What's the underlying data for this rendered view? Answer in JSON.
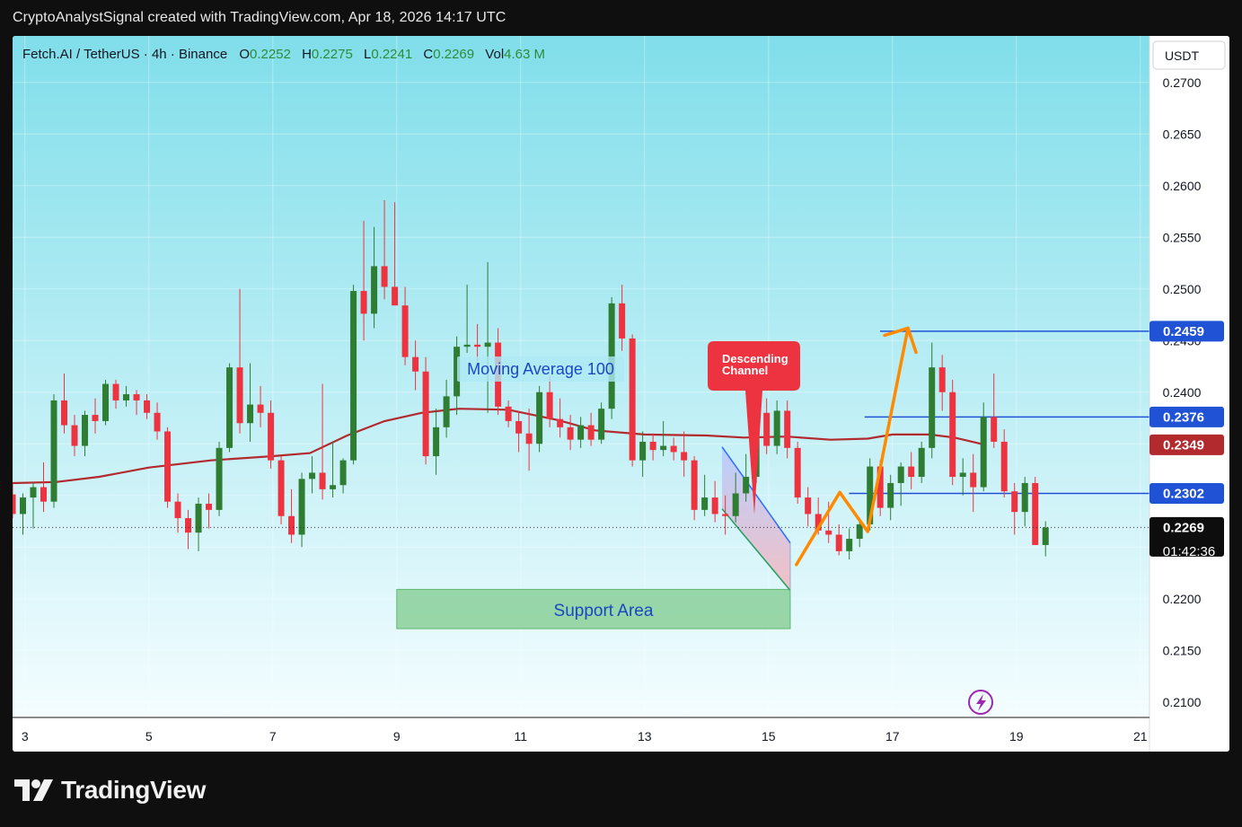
{
  "header": {
    "attribution": "CryptoAnalystSignal created with TradingView.com, Apr 18, 2026 14:17 UTC"
  },
  "legend": {
    "symbol": "Fetch.AI / TetherUS · 4h · Binance",
    "o_label": "O",
    "o_value": "0.2252",
    "h_label": "H",
    "h_value": "0.2275",
    "l_label": "L",
    "l_value": "0.2241",
    "c_label": "C",
    "c_value": "0.2269",
    "vol_label": "Vol",
    "vol_value": "4.63 M"
  },
  "currency_button": "USDT",
  "countdown": "01:42:36",
  "annotations": {
    "moving_average": "Moving Average 100",
    "descending_channel_line1": "Descending",
    "descending_channel_line2": "Channel",
    "support_area": "Support Area"
  },
  "brand": {
    "name": "TradingView"
  },
  "colors": {
    "up": "#2e7d32",
    "down": "#ee3340",
    "ma": "#b2292e",
    "level": "#2052d6",
    "arrow": "#ff8a00",
    "support": "#8fd19e",
    "bg_top": "#80deea",
    "bg_bottom": "#f4fdff"
  },
  "chart_data": {
    "type": "candlestick",
    "ylim": [
      0.2085,
      0.2745
    ],
    "y_ticks": [
      "0.2100",
      "0.2150",
      "0.2200",
      "0.2250",
      "0.2300",
      "0.2350",
      "0.2400",
      "0.2450",
      "0.2500",
      "0.2550",
      "0.2600",
      "0.2650",
      "0.2700"
    ],
    "x_ticks": [
      "3",
      "5",
      "7",
      "9",
      "11",
      "13",
      "15",
      "17",
      "19",
      "21"
    ],
    "x_tick_days": [
      3,
      5,
      7,
      9,
      11,
      13,
      15,
      17,
      19,
      21
    ],
    "candle_interval_days": 0.1667,
    "price_labels": [
      {
        "value": 0.2459,
        "text": "0.2459",
        "color": "#2052d6"
      },
      {
        "value": 0.2376,
        "text": "0.2376",
        "color": "#2052d6"
      },
      {
        "value": 0.2349,
        "text": "0.2349",
        "color": "#b2292e"
      },
      {
        "value": 0.2302,
        "text": "0.2302",
        "color": "#2052d6"
      },
      {
        "value": 0.2269,
        "text": "0.2269",
        "color": "#0d0d0d"
      }
    ],
    "levels": [
      {
        "value": 0.2459,
        "from_day": 16.8
      },
      {
        "value": 0.2376,
        "from_day": 16.55
      },
      {
        "value": 0.2302,
        "from_day": 16.3
      }
    ],
    "current_price": 0.2269,
    "support_zone": {
      "day_from": 9.0,
      "day_to": 15.35,
      "price_top": 0.2209,
      "price_bottom": 0.2171
    },
    "descending_channel": {
      "upper": [
        [
          14.25,
          0.2347
        ],
        [
          15.35,
          0.2254
        ]
      ],
      "lower": [
        [
          14.25,
          0.2287
        ],
        [
          15.35,
          0.2208
        ]
      ]
    },
    "projection_path": [
      [
        15.45,
        0.2233
      ],
      [
        16.15,
        0.2303
      ],
      [
        16.6,
        0.2265
      ],
      [
        17.25,
        0.2462
      ]
    ],
    "moving_average_100": [
      [
        2.8,
        0.2312
      ],
      [
        3.5,
        0.2313
      ],
      [
        4.2,
        0.2318
      ],
      [
        5.0,
        0.2327
      ],
      [
        6.0,
        0.2334
      ],
      [
        7.0,
        0.2338
      ],
      [
        7.6,
        0.2341
      ],
      [
        8.2,
        0.2358
      ],
      [
        8.8,
        0.2372
      ],
      [
        9.4,
        0.238
      ],
      [
        10.0,
        0.2384
      ],
      [
        10.8,
        0.2383
      ],
      [
        11.6,
        0.2373
      ],
      [
        12.2,
        0.2363
      ],
      [
        13.0,
        0.2359
      ],
      [
        14.0,
        0.2358
      ],
      [
        14.6,
        0.2356
      ],
      [
        15.3,
        0.2357
      ],
      [
        16.0,
        0.2354
      ],
      [
        16.6,
        0.2355
      ],
      [
        17.0,
        0.2359
      ],
      [
        17.6,
        0.2359
      ],
      [
        18.0,
        0.2356
      ],
      [
        18.5,
        0.2349
      ]
    ],
    "candles": [
      [
        0.2301,
        0.2312,
        0.2278,
        0.2282
      ],
      [
        0.2282,
        0.2302,
        0.2262,
        0.2298
      ],
      [
        0.2298,
        0.2312,
        0.2268,
        0.2308
      ],
      [
        0.2308,
        0.2332,
        0.2284,
        0.2294
      ],
      [
        0.2294,
        0.2398,
        0.2288,
        0.2392
      ],
      [
        0.2392,
        0.2418,
        0.236,
        0.2368
      ],
      [
        0.2368,
        0.2378,
        0.2338,
        0.2348
      ],
      [
        0.2348,
        0.2382,
        0.2338,
        0.2378
      ],
      [
        0.2378,
        0.2394,
        0.236,
        0.2372
      ],
      [
        0.2372,
        0.2412,
        0.2368,
        0.2408
      ],
      [
        0.2408,
        0.2412,
        0.2384,
        0.2392
      ],
      [
        0.2392,
        0.2406,
        0.2386,
        0.2398
      ],
      [
        0.2398,
        0.2402,
        0.2378,
        0.2392
      ],
      [
        0.2392,
        0.2398,
        0.2374,
        0.238
      ],
      [
        0.238,
        0.239,
        0.2354,
        0.2362
      ],
      [
        0.2362,
        0.2366,
        0.2288,
        0.2294
      ],
      [
        0.2294,
        0.2302,
        0.2264,
        0.2278
      ],
      [
        0.2278,
        0.2286,
        0.2248,
        0.2264
      ],
      [
        0.2264,
        0.2298,
        0.2246,
        0.2292
      ],
      [
        0.2292,
        0.2302,
        0.2268,
        0.2286
      ],
      [
        0.2286,
        0.2352,
        0.228,
        0.2346
      ],
      [
        0.2346,
        0.2428,
        0.2342,
        0.2424
      ],
      [
        0.2424,
        0.25,
        0.236,
        0.237
      ],
      [
        0.237,
        0.2428,
        0.2352,
        0.2388
      ],
      [
        0.2388,
        0.2406,
        0.2366,
        0.238
      ],
      [
        0.238,
        0.2392,
        0.2326,
        0.2334
      ],
      [
        0.2334,
        0.2338,
        0.2272,
        0.228
      ],
      [
        0.228,
        0.2306,
        0.2254,
        0.2262
      ],
      [
        0.2262,
        0.2322,
        0.225,
        0.2316
      ],
      [
        0.2316,
        0.2338,
        0.2302,
        0.2322
      ],
      [
        0.2322,
        0.2408,
        0.2296,
        0.2306
      ],
      [
        0.2306,
        0.2352,
        0.2298,
        0.231
      ],
      [
        0.231,
        0.2336,
        0.2302,
        0.2334
      ],
      [
        0.2334,
        0.2504,
        0.233,
        0.2498
      ],
      [
        0.2498,
        0.2566,
        0.245,
        0.2476
      ],
      [
        0.2476,
        0.256,
        0.2462,
        0.2522
      ],
      [
        0.2522,
        0.2586,
        0.249,
        0.2502
      ],
      [
        0.2502,
        0.2584,
        0.2488,
        0.2484
      ],
      [
        0.2484,
        0.2502,
        0.2426,
        0.2434
      ],
      [
        0.2434,
        0.245,
        0.2402,
        0.242
      ],
      [
        0.242,
        0.2434,
        0.233,
        0.2338
      ],
      [
        0.2338,
        0.2384,
        0.232,
        0.2366
      ],
      [
        0.2366,
        0.2412,
        0.2356,
        0.2396
      ],
      [
        0.2396,
        0.2454,
        0.2378,
        0.2444
      ],
      [
        0.2444,
        0.2504,
        0.2438,
        0.2446
      ],
      [
        0.2446,
        0.2466,
        0.243,
        0.2444
      ],
      [
        0.2444,
        0.2526,
        0.238,
        0.2448
      ],
      [
        0.2448,
        0.2462,
        0.2378,
        0.2386
      ],
      [
        0.2386,
        0.2392,
        0.2366,
        0.2372
      ],
      [
        0.2372,
        0.2382,
        0.2342,
        0.236
      ],
      [
        0.236,
        0.2384,
        0.2324,
        0.235
      ],
      [
        0.235,
        0.2406,
        0.2342,
        0.24
      ],
      [
        0.24,
        0.2416,
        0.2366,
        0.2374
      ],
      [
        0.2374,
        0.2394,
        0.2356,
        0.2366
      ],
      [
        0.2366,
        0.2378,
        0.2344,
        0.2354
      ],
      [
        0.2354,
        0.2376,
        0.2346,
        0.2368
      ],
      [
        0.2368,
        0.238,
        0.2348,
        0.2354
      ],
      [
        0.2354,
        0.239,
        0.235,
        0.2384
      ],
      [
        0.2384,
        0.2492,
        0.2374,
        0.2486
      ],
      [
        0.2486,
        0.2504,
        0.244,
        0.2452
      ],
      [
        0.2452,
        0.2456,
        0.2328,
        0.2334
      ],
      [
        0.2334,
        0.2362,
        0.2318,
        0.2352
      ],
      [
        0.2352,
        0.236,
        0.2334,
        0.2344
      ],
      [
        0.2344,
        0.2372,
        0.2338,
        0.2348
      ],
      [
        0.2348,
        0.2356,
        0.2334,
        0.2342
      ],
      [
        0.2342,
        0.2362,
        0.2318,
        0.2334
      ],
      [
        0.2334,
        0.2338,
        0.2276,
        0.2286
      ],
      [
        0.2286,
        0.232,
        0.228,
        0.2298
      ],
      [
        0.2298,
        0.2314,
        0.2274,
        0.2282
      ],
      [
        0.2282,
        0.23,
        0.2262,
        0.228
      ],
      [
        0.228,
        0.2322,
        0.2274,
        0.2302
      ],
      [
        0.2302,
        0.234,
        0.2294,
        0.2318
      ],
      [
        0.2318,
        0.2412,
        0.2312,
        0.238
      ],
      [
        0.238,
        0.2394,
        0.234,
        0.2348
      ],
      [
        0.2348,
        0.2392,
        0.234,
        0.2382
      ],
      [
        0.2382,
        0.2392,
        0.2336,
        0.2346
      ],
      [
        0.2346,
        0.2352,
        0.2292,
        0.2298
      ],
      [
        0.2298,
        0.2308,
        0.227,
        0.2282
      ],
      [
        0.2282,
        0.2298,
        0.2262,
        0.2266
      ],
      [
        0.2266,
        0.2294,
        0.2254,
        0.2262
      ],
      [
        0.2262,
        0.2272,
        0.2242,
        0.2246
      ],
      [
        0.2246,
        0.2268,
        0.2238,
        0.2258
      ],
      [
        0.2258,
        0.2278,
        0.225,
        0.2272
      ],
      [
        0.2272,
        0.2336,
        0.2266,
        0.2328
      ],
      [
        0.2328,
        0.2334,
        0.228,
        0.2288
      ],
      [
        0.2288,
        0.232,
        0.2276,
        0.2312
      ],
      [
        0.2312,
        0.2332,
        0.229,
        0.2328
      ],
      [
        0.2328,
        0.2342,
        0.2306,
        0.2318
      ],
      [
        0.2318,
        0.2352,
        0.2312,
        0.2346
      ],
      [
        0.2346,
        0.2448,
        0.2336,
        0.2424
      ],
      [
        0.2424,
        0.2436,
        0.2382,
        0.24
      ],
      [
        0.24,
        0.2412,
        0.231,
        0.2318
      ],
      [
        0.2318,
        0.2336,
        0.23,
        0.2322
      ],
      [
        0.2322,
        0.234,
        0.2284,
        0.2308
      ],
      [
        0.2308,
        0.239,
        0.2304,
        0.2376
      ],
      [
        0.2376,
        0.2418,
        0.2346,
        0.2352
      ],
      [
        0.2352,
        0.2364,
        0.2298,
        0.2304
      ],
      [
        0.2304,
        0.2312,
        0.2262,
        0.2284
      ],
      [
        0.2284,
        0.2318,
        0.227,
        0.2312
      ],
      [
        0.2312,
        0.2318,
        0.2256,
        0.2252
      ],
      [
        0.2252,
        0.2275,
        0.2241,
        0.2269
      ]
    ]
  }
}
